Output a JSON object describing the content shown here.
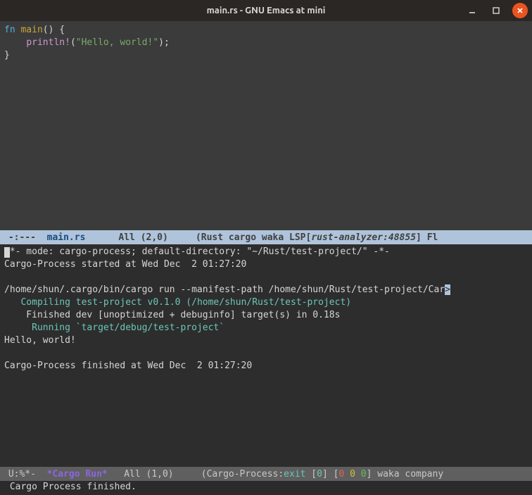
{
  "titlebar": {
    "title": "main.rs - GNU Emacs at mini"
  },
  "code": {
    "l1_kw": "fn",
    "l1_space": " ",
    "l1_fn": "main",
    "l1_rest": "() {",
    "l2_indent": "    ",
    "l2_macro": "println!",
    "l2_open": "(",
    "l2_str": "\"Hello, world!\"",
    "l2_close": ");",
    "l3": "}"
  },
  "modeline1": {
    "left": " -:---  ",
    "fname": "main.rs",
    "mid": "      All (2,0)     (Rust cargo waka LSP[",
    "lsp": "rust-analyzer:48855",
    "right": "] Fl"
  },
  "cargo": {
    "l1": "-*- mode: cargo-process; default-directory: \"~/Rust/test-project/\" -*-",
    "l2": "Cargo-Process started at Wed Dec  2 01:27:20",
    "l3": "",
    "l4": "/home/shun/.cargo/bin/cargo run --manifest-path /home/shun/Rust/test-project/Car",
    "l5_lead": "   ",
    "l5_comp": "Compiling",
    "l5_rest": " test-project v0.1.0 (/home/shun/Rust/test-project)",
    "l6": "    Finished dev [unoptimized + debuginfo] target(s) in 0.18s",
    "l7_lead": "     ",
    "l7_run": "Running",
    "l7_rest": " `target/debug/test-project`",
    "l8": "Hello, world!",
    "l9": "",
    "l10": "Cargo-Process finished at Wed Dec  2 01:27:20"
  },
  "modeline2": {
    "left": " U:%*-  ",
    "fname": "*Cargo Run*",
    "mid": "   All (1,0)     (Cargo-Process:",
    "exit": "exit",
    "br1": " [",
    "z0": "0",
    "br2": "] [",
    "za": "0",
    "sp1": " ",
    "zb": "0",
    "sp2": " ",
    "zc": "0",
    "br3": "] waka company"
  },
  "minibuf": {
    "text": " Cargo Process finished."
  }
}
